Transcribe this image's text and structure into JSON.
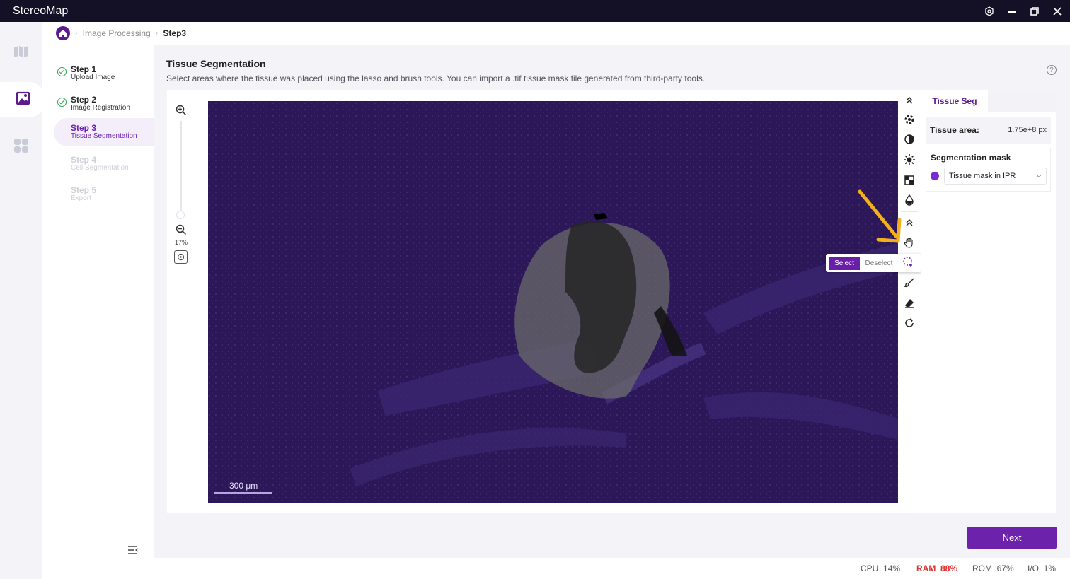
{
  "app": {
    "title": "StereoMap"
  },
  "window_controls": [
    "settings-icon",
    "minimize-icon",
    "restore-icon",
    "close-icon"
  ],
  "rail": {
    "items": [
      "map-icon",
      "image-processing-icon",
      "apps-icon"
    ],
    "active": "image-processing-icon"
  },
  "breadcrumb": {
    "items": [
      "Image Processing",
      "Step3"
    ]
  },
  "steps": [
    {
      "title": "Step 1",
      "subtitle": "Upload Image",
      "state": "done"
    },
    {
      "title": "Step 2",
      "subtitle": "Image Registration",
      "state": "done"
    },
    {
      "title": "Step 3",
      "subtitle": "Tissue Segmentation",
      "state": "active"
    },
    {
      "title": "Step 4",
      "subtitle": "Cell Segmentation",
      "state": "disabled"
    },
    {
      "title": "Step 5",
      "subtitle": "Export",
      "state": "disabled"
    }
  ],
  "main": {
    "title": "Tissue Segmentation",
    "description": "Select areas where the tissue was placed using the lasso and brush tools. You can import a .tif tissue mask file generated from third-party tools."
  },
  "viewer": {
    "zoom_label": "17%",
    "scale_bar_label": "300 μm"
  },
  "tools": [
    "collapse-up-icon",
    "settings-gear-icon",
    "contrast-icon",
    "brightness-icon",
    "checker-icon",
    "drop-icon",
    "collapse-up-icon",
    "hand-icon",
    "lasso-icon",
    "brush-icon",
    "eraser-icon",
    "redo-icon"
  ],
  "select_popup": {
    "select_label": "Select",
    "deselect_label": "Deselect"
  },
  "right_panel": {
    "tab_label": "Tissue Seg",
    "area_label": "Tissue area:",
    "area_value": "1.75e+8 px",
    "mask_label": "Segmentation mask",
    "mask_value": "Tissue mask in IPR",
    "mask_color": "#7a2ad4"
  },
  "next_label": "Next",
  "status": {
    "cpu_label": "CPU",
    "cpu_value": "14%",
    "ram_label": "RAM",
    "ram_value": "88%",
    "rom_label": "ROM",
    "rom_value": "67%",
    "io_label": "I/O",
    "io_value": "1%"
  },
  "colors": {
    "accent": "#6c22aa",
    "titlebar": "#141026",
    "warning": "#e03030",
    "success": "#2aa44f",
    "arrow": "#f2b01e"
  }
}
